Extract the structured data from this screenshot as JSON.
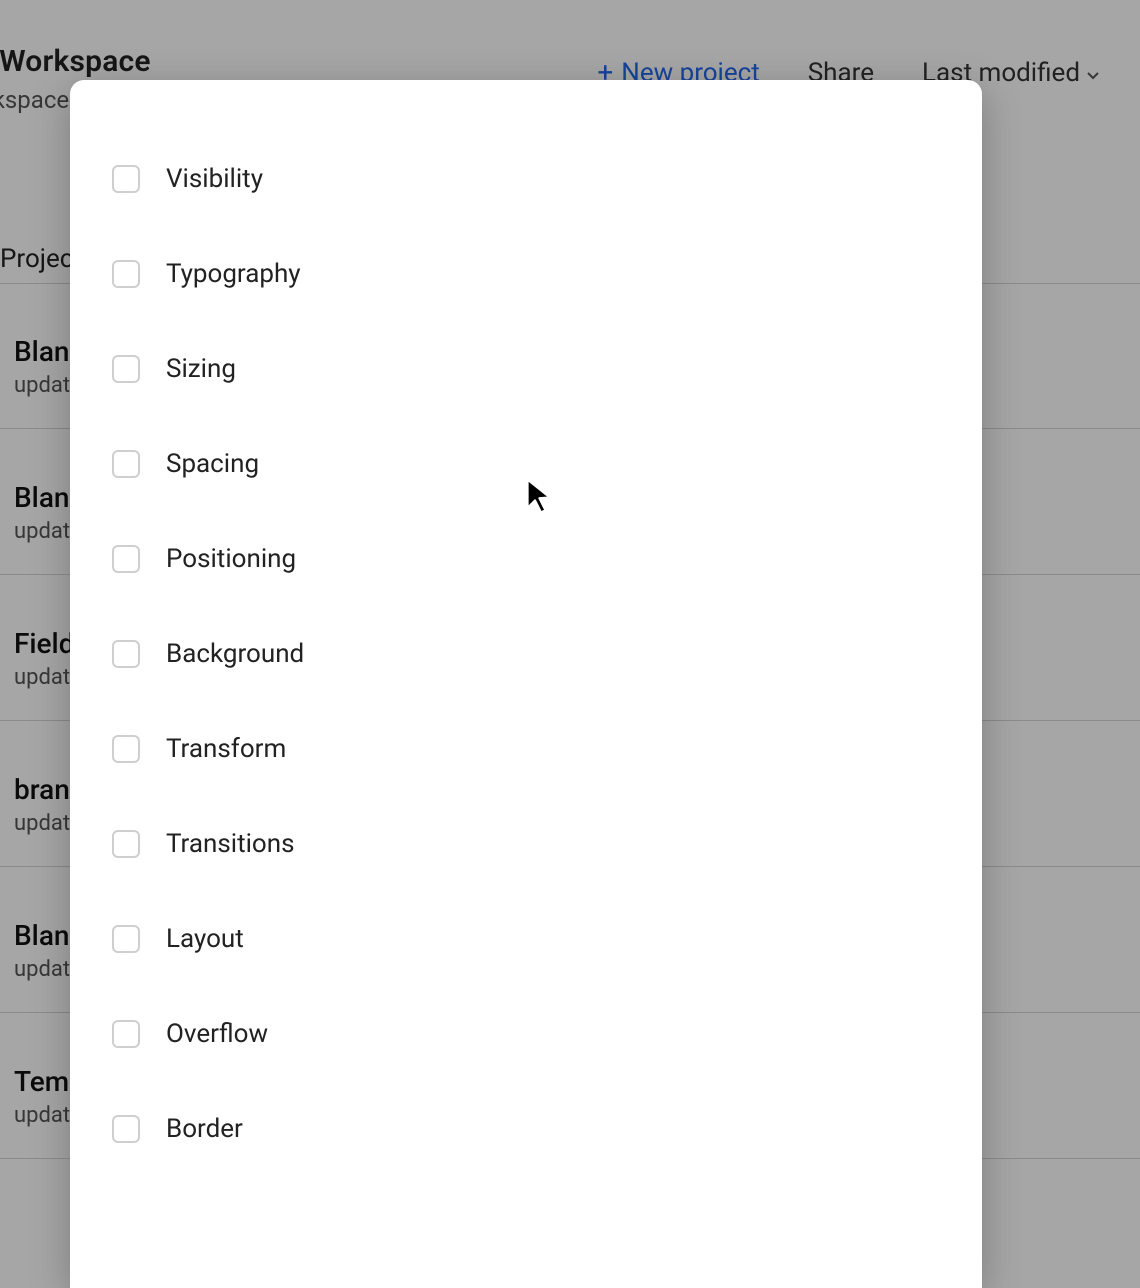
{
  "header": {
    "title": "My Workspace",
    "subtitle": "Workspace",
    "new_project_label": "New project",
    "share_label": "Share",
    "sort_label": "Last modified"
  },
  "tab_label": "Projects",
  "projects": [
    {
      "name": "Blank",
      "sub": "updated"
    },
    {
      "name": "Blank",
      "sub": "updated"
    },
    {
      "name": "Field",
      "sub": "updated"
    },
    {
      "name": "brand",
      "sub": "updated"
    },
    {
      "name": "Blank",
      "sub": "updated"
    },
    {
      "name": "Temp",
      "sub": "updated"
    }
  ],
  "modal_options": [
    {
      "label": "Visibility"
    },
    {
      "label": "Typography"
    },
    {
      "label": "Sizing"
    },
    {
      "label": "Spacing"
    },
    {
      "label": "Positioning"
    },
    {
      "label": "Background"
    },
    {
      "label": "Transform"
    },
    {
      "label": "Transitions"
    },
    {
      "label": "Layout"
    },
    {
      "label": "Overflow"
    },
    {
      "label": "Border"
    }
  ]
}
